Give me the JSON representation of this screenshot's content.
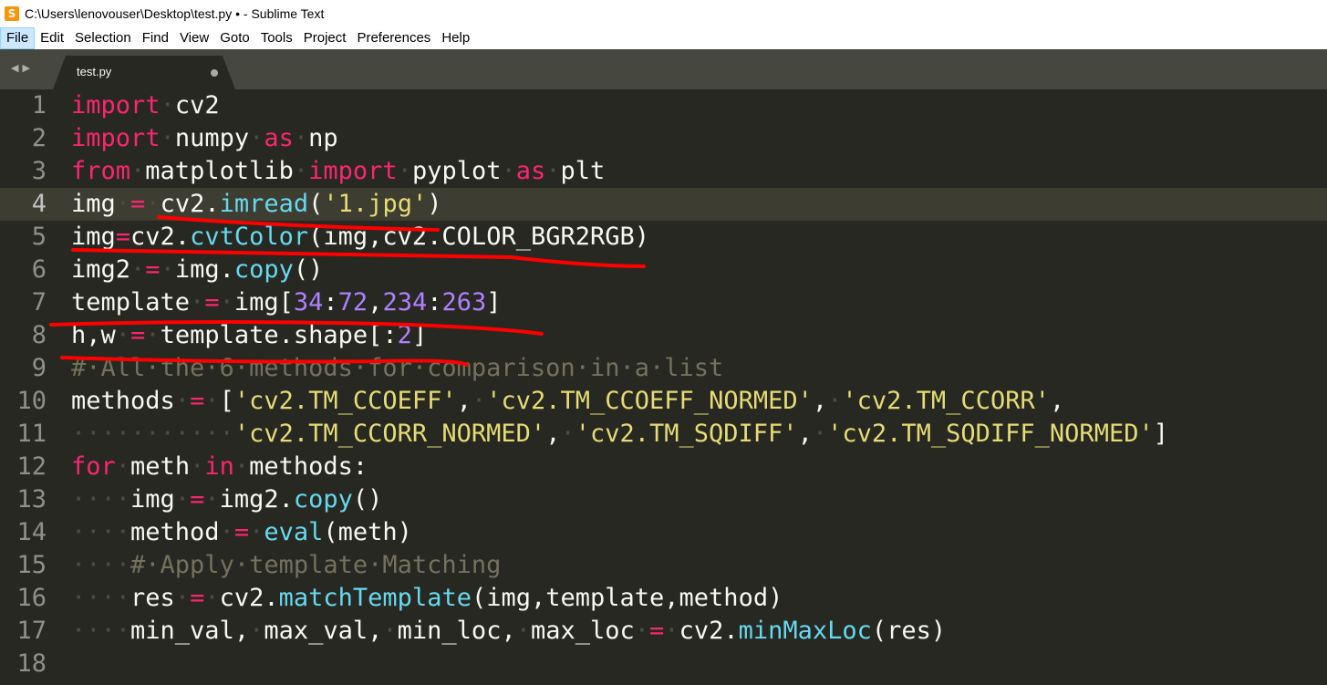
{
  "window": {
    "title": "C:\\Users\\lenovouser\\Desktop\\test.py • - Sublime Text"
  },
  "menu": [
    "File",
    "Edit",
    "Selection",
    "Find",
    "View",
    "Goto",
    "Tools",
    "Project",
    "Preferences",
    "Help"
  ],
  "tab": {
    "filename": "test.py"
  },
  "editor": {
    "current_line": 4,
    "lines": [
      {
        "n": "1",
        "t": [
          [
            "kw",
            "import"
          ],
          [
            "ws",
            "·"
          ],
          [
            "",
            "cv2"
          ]
        ]
      },
      {
        "n": "2",
        "t": [
          [
            "kw",
            "import"
          ],
          [
            "ws",
            "·"
          ],
          [
            "",
            "numpy"
          ],
          [
            "ws",
            "·"
          ],
          [
            "kw",
            "as"
          ],
          [
            "ws",
            "·"
          ],
          [
            "",
            "np"
          ]
        ]
      },
      {
        "n": "3",
        "t": [
          [
            "kw",
            "from"
          ],
          [
            "ws",
            "·"
          ],
          [
            "",
            "matplotlib"
          ],
          [
            "ws",
            "·"
          ],
          [
            "kw",
            "import"
          ],
          [
            "ws",
            "·"
          ],
          [
            "",
            "pyplot"
          ],
          [
            "ws",
            "·"
          ],
          [
            "kw",
            "as"
          ],
          [
            "ws",
            "·"
          ],
          [
            "",
            "plt"
          ]
        ]
      },
      {
        "n": "4",
        "t": [
          [
            "",
            "img"
          ],
          [
            "ws",
            "·"
          ],
          [
            "kw",
            "="
          ],
          [
            "ws",
            "·"
          ],
          [
            "",
            "cv2."
          ],
          [
            "fn",
            "imread"
          ],
          [
            "",
            "("
          ],
          [
            "str",
            "'1.jpg'"
          ],
          [
            "",
            ")"
          ]
        ]
      },
      {
        "n": "5",
        "t": [
          [
            "",
            "img"
          ],
          [
            "kw",
            "="
          ],
          [
            "",
            "cv2."
          ],
          [
            "fn",
            "cvtColor"
          ],
          [
            "",
            "(img,cv2.COLOR_BGR2RGB)"
          ]
        ]
      },
      {
        "n": "6",
        "t": [
          [
            "",
            "img2"
          ],
          [
            "ws",
            "·"
          ],
          [
            "kw",
            "="
          ],
          [
            "ws",
            "·"
          ],
          [
            "",
            "img."
          ],
          [
            "fn",
            "copy"
          ],
          [
            "",
            "()"
          ]
        ]
      },
      {
        "n": "7",
        "t": [
          [
            "",
            "template"
          ],
          [
            "ws",
            "·"
          ],
          [
            "kw",
            "="
          ],
          [
            "ws",
            "·"
          ],
          [
            "",
            "img["
          ],
          [
            "num",
            "34"
          ],
          [
            "",
            ":"
          ],
          [
            "num",
            "72"
          ],
          [
            "",
            ","
          ],
          [
            "num",
            "234"
          ],
          [
            "",
            ":"
          ],
          [
            "num",
            "263"
          ],
          [
            "",
            "]"
          ]
        ]
      },
      {
        "n": "8",
        "t": [
          [
            "",
            "h,w"
          ],
          [
            "ws",
            "·"
          ],
          [
            "kw",
            "="
          ],
          [
            "ws",
            "·"
          ],
          [
            "",
            "template.shape[:"
          ],
          [
            "num",
            "2"
          ],
          [
            "",
            "]"
          ]
        ]
      },
      {
        "n": "9",
        "t": [
          [
            "cm",
            "#·All·the·6·methods·for·comparison·in·a·list"
          ]
        ]
      },
      {
        "n": "10",
        "t": [
          [
            "",
            "methods"
          ],
          [
            "ws",
            "·"
          ],
          [
            "kw",
            "="
          ],
          [
            "ws",
            "·"
          ],
          [
            "",
            "["
          ],
          [
            "str",
            "'cv2.TM_CCOEFF'"
          ],
          [
            "",
            ","
          ],
          [
            "ws",
            "·"
          ],
          [
            "str",
            "'cv2.TM_CCOEFF_NORMED'"
          ],
          [
            "",
            ","
          ],
          [
            "ws",
            "·"
          ],
          [
            "str",
            "'cv2.TM_CCORR'"
          ],
          [
            "",
            ","
          ]
        ]
      },
      {
        "n": "11",
        "t": [
          [
            "ws",
            "···········"
          ],
          [
            "str",
            "'cv2.TM_CCORR_NORMED'"
          ],
          [
            "",
            ","
          ],
          [
            "ws",
            "·"
          ],
          [
            "str",
            "'cv2.TM_SQDIFF'"
          ],
          [
            "",
            ","
          ],
          [
            "ws",
            "·"
          ],
          [
            "str",
            "'cv2.TM_SQDIFF_NORMED'"
          ],
          [
            "",
            "]"
          ]
        ]
      },
      {
        "n": "12",
        "t": [
          [
            "kw",
            "for"
          ],
          [
            "ws",
            "·"
          ],
          [
            "",
            "meth"
          ],
          [
            "ws",
            "·"
          ],
          [
            "kw",
            "in"
          ],
          [
            "ws",
            "·"
          ],
          [
            "",
            "methods:"
          ]
        ]
      },
      {
        "n": "13",
        "t": [
          [
            "ws",
            "····"
          ],
          [
            "",
            "img"
          ],
          [
            "ws",
            "·"
          ],
          [
            "kw",
            "="
          ],
          [
            "ws",
            "·"
          ],
          [
            "",
            "img2."
          ],
          [
            "fn",
            "copy"
          ],
          [
            "",
            "()"
          ]
        ]
      },
      {
        "n": "14",
        "t": [
          [
            "ws",
            "····"
          ],
          [
            "",
            "method"
          ],
          [
            "ws",
            "·"
          ],
          [
            "kw",
            "="
          ],
          [
            "ws",
            "·"
          ],
          [
            "fn",
            "eval"
          ],
          [
            "",
            "(meth)"
          ]
        ]
      },
      {
        "n": "15",
        "t": [
          [
            "ws",
            "····"
          ],
          [
            "cm",
            "#·Apply·template·Matching"
          ]
        ]
      },
      {
        "n": "16",
        "t": [
          [
            "ws",
            "····"
          ],
          [
            "",
            "res"
          ],
          [
            "ws",
            "·"
          ],
          [
            "kw",
            "="
          ],
          [
            "ws",
            "·"
          ],
          [
            "",
            "cv2."
          ],
          [
            "fn",
            "matchTemplate"
          ],
          [
            "",
            "(img,template,method)"
          ]
        ]
      },
      {
        "n": "17",
        "t": [
          [
            "ws",
            "····"
          ],
          [
            "",
            "min_val,"
          ],
          [
            "ws",
            "·"
          ],
          [
            "",
            "max_val,"
          ],
          [
            "ws",
            "·"
          ],
          [
            "",
            "min_loc,"
          ],
          [
            "ws",
            "·"
          ],
          [
            "",
            "max_loc"
          ],
          [
            "ws",
            "·"
          ],
          [
            "kw",
            "="
          ],
          [
            "ws",
            "·"
          ],
          [
            "",
            "cv2."
          ],
          [
            "fn",
            "minMaxLoc"
          ],
          [
            "",
            "(res)"
          ]
        ]
      },
      {
        "n": "18",
        "t": []
      }
    ]
  },
  "annotation": {
    "color": "#ff0000"
  }
}
